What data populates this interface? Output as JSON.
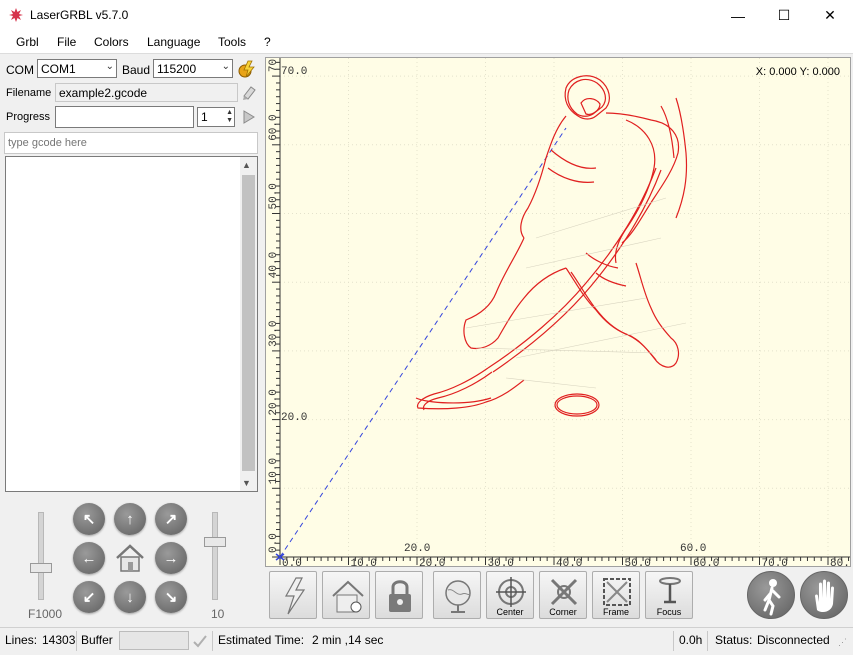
{
  "window": {
    "title": "LaserGRBL v5.7.0",
    "controls": {
      "minimize": "—",
      "maximize": "☐",
      "close": "✕"
    }
  },
  "menu": [
    "Grbl",
    "File",
    "Colors",
    "Language",
    "Tools",
    "?"
  ],
  "connection": {
    "com_label": "COM",
    "com_value": "COM1",
    "baud_label": "Baud",
    "baud_value": "115200"
  },
  "file": {
    "filename_label": "Filename",
    "filename_value": "example2.gcode",
    "progress_label": "Progress",
    "progress_fraction": 0,
    "copies_value": "1"
  },
  "command": {
    "placeholder": "type gcode here"
  },
  "jog": {
    "speed_label": "F1000",
    "step_label": "10",
    "speed_level": 0.35,
    "step_level": 0.65
  },
  "canvas": {
    "coords": "X: 0.000 Y: 0.000",
    "x_ticks": [
      "0.0",
      "10.0",
      "20.0",
      "30.0",
      "40.0",
      "50.0",
      "60.0",
      "70.0",
      "80."
    ],
    "x_top_labels": [
      "20.0",
      "60.0"
    ],
    "y_ticks": [
      "0.0",
      "10.0",
      "20.0",
      "30.0",
      "40.0",
      "50.0",
      "60.0",
      "70.0"
    ],
    "y_inner_labels": [
      "20.0",
      "70.0"
    ],
    "background": "#fffde6",
    "path_color": "#e02020",
    "rapid_color": "#3344dd"
  },
  "toolbar": {
    "center": "Center",
    "corner": "Corner",
    "frame": "Frame",
    "focus": "Focus"
  },
  "status": {
    "lines_label": "Lines:",
    "lines_value": "14303",
    "buffer_label": "Buffer",
    "estimated_label": "Estimated Time:",
    "estimated_value": "2 min ,14 sec",
    "time_value": "0.0h",
    "status_label": "Status:",
    "status_value": "Disconnected"
  }
}
